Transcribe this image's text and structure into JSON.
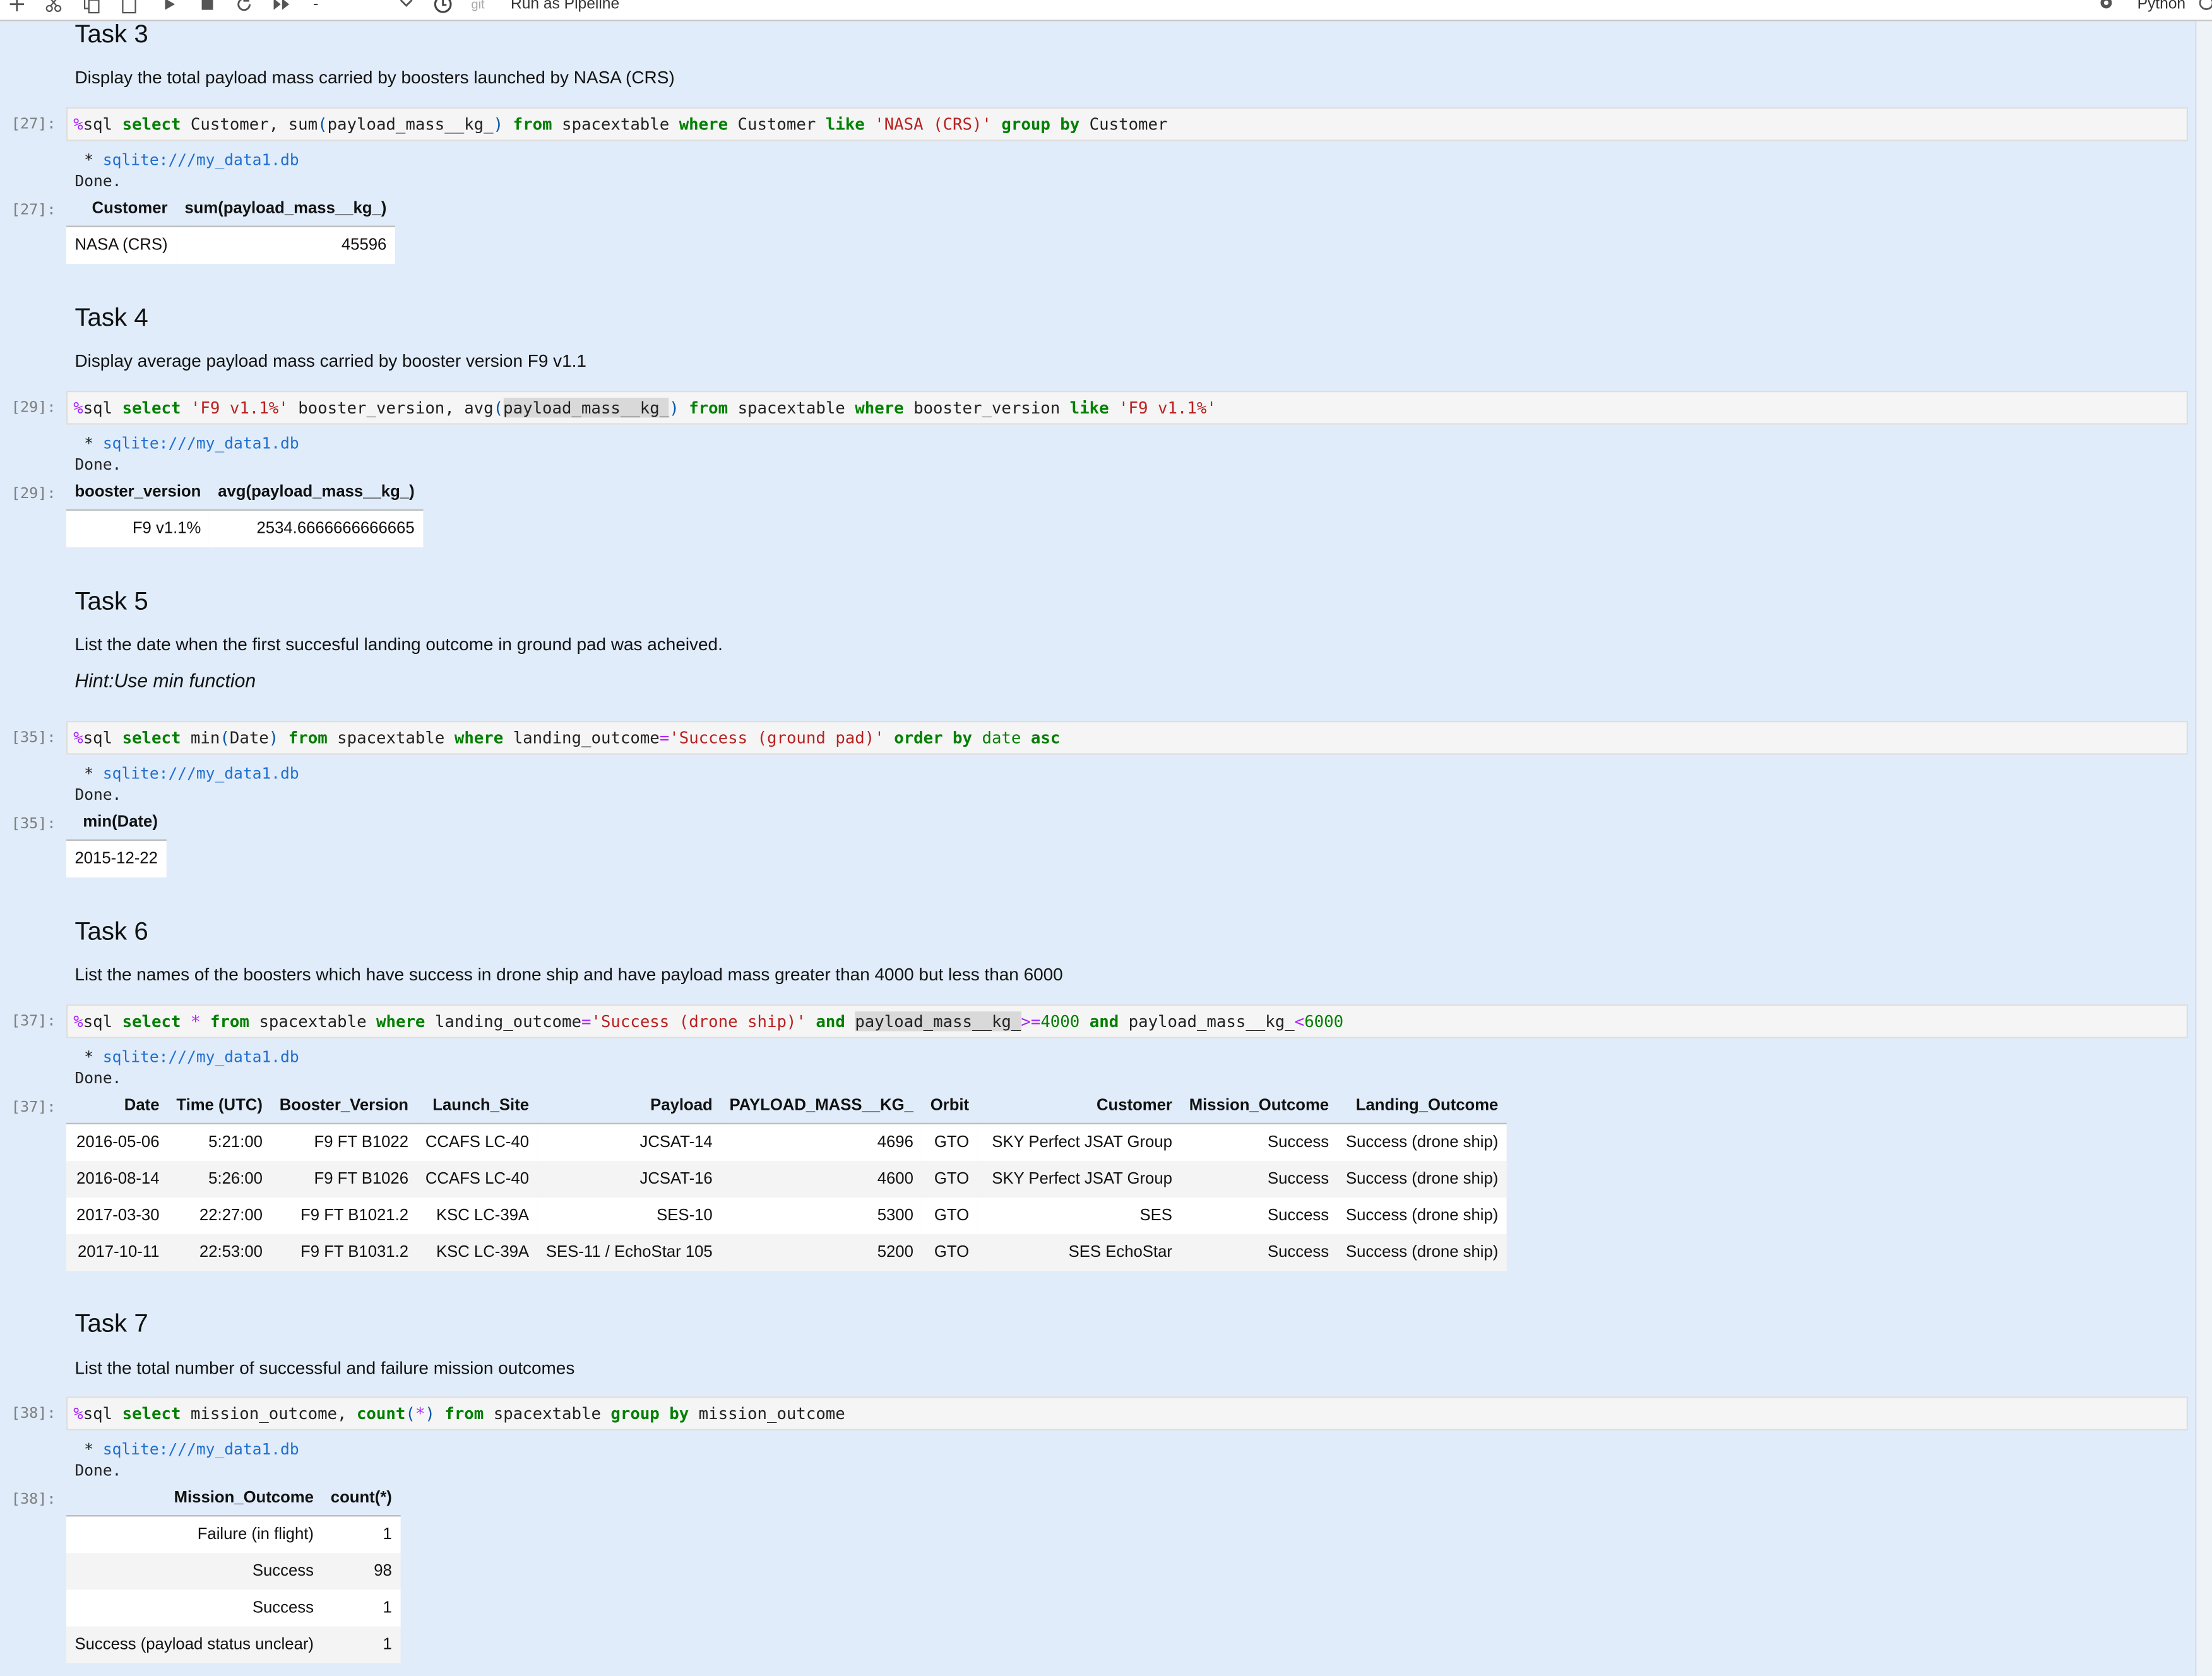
{
  "toolbar": {
    "cell_type": "-",
    "git_label": "git",
    "pipeline_label": "Run as Pipeline",
    "kernel_label": "Python"
  },
  "cells": {
    "task3": {
      "heading": "Task 3",
      "desc": "Display the total payload mass carried by boosters launched by NASA (CRS)",
      "prompt_in": "[27]:",
      "prompt_out": "[27]:",
      "connection": "sqlite:///my_data1.db",
      "done": "Done.",
      "columns": [
        "Customer",
        "sum(payload_mass__kg_)"
      ],
      "rows": [
        [
          "NASA (CRS)",
          "45596"
        ]
      ]
    },
    "task4": {
      "heading": "Task 4",
      "desc": "Display average payload mass carried by booster version F9 v1.1",
      "prompt_in": "[29]:",
      "prompt_out": "[29]:",
      "connection": "sqlite:///my_data1.db",
      "done": "Done.",
      "columns": [
        "booster_version",
        "avg(payload_mass__kg_)"
      ],
      "rows": [
        [
          "F9 v1.1%",
          "2534.6666666666665"
        ]
      ]
    },
    "task5": {
      "heading": "Task 5",
      "desc": "List the date when the first succesful landing outcome in ground pad was acheived.",
      "hint": "Hint:Use min function",
      "prompt_in": "[35]:",
      "prompt_out": "[35]:",
      "connection": "sqlite:///my_data1.db",
      "done": "Done.",
      "columns": [
        "min(Date)"
      ],
      "rows": [
        [
          "2015-12-22"
        ]
      ]
    },
    "task6": {
      "heading": "Task 6",
      "desc": "List the names of the boosters which have success in drone ship and have payload mass greater than 4000 but less than 6000",
      "prompt_in": "[37]:",
      "prompt_out": "[37]:",
      "connection": "sqlite:///my_data1.db",
      "done": "Done.",
      "columns": [
        "Date",
        "Time (UTC)",
        "Booster_Version",
        "Launch_Site",
        "Payload",
        "PAYLOAD_MASS__KG_",
        "Orbit",
        "Customer",
        "Mission_Outcome",
        "Landing_Outcome"
      ],
      "rows": [
        [
          "2016-05-06",
          "5:21:00",
          "F9 FT B1022",
          "CCAFS LC-40",
          "JCSAT-14",
          "4696",
          "GTO",
          "SKY Perfect JSAT Group",
          "Success",
          "Success (drone ship)"
        ],
        [
          "2016-08-14",
          "5:26:00",
          "F9 FT B1026",
          "CCAFS LC-40",
          "JCSAT-16",
          "4600",
          "GTO",
          "SKY Perfect JSAT Group",
          "Success",
          "Success (drone ship)"
        ],
        [
          "2017-03-30",
          "22:27:00",
          "F9 FT B1021.2",
          "KSC LC-39A",
          "SES-10",
          "5300",
          "GTO",
          "SES",
          "Success",
          "Success (drone ship)"
        ],
        [
          "2017-10-11",
          "22:53:00",
          "F9 FT B1031.2",
          "KSC LC-39A",
          "SES-11 / EchoStar 105",
          "5200",
          "GTO",
          "SES EchoStar",
          "Success",
          "Success (drone ship)"
        ]
      ]
    },
    "task7": {
      "heading": "Task 7",
      "desc": "List the total number of successful and failure mission outcomes",
      "prompt_in": "[38]:",
      "prompt_out": "[38]:",
      "connection": "sqlite:///my_data1.db",
      "done": "Done.",
      "columns": [
        "Mission_Outcome",
        "count(*)"
      ],
      "rows": [
        [
          "Failure (in flight)",
          "1"
        ],
        [
          "Success",
          "98"
        ],
        [
          "Success",
          "1"
        ],
        [
          "Success (payload status unclear)",
          "1"
        ]
      ]
    }
  }
}
